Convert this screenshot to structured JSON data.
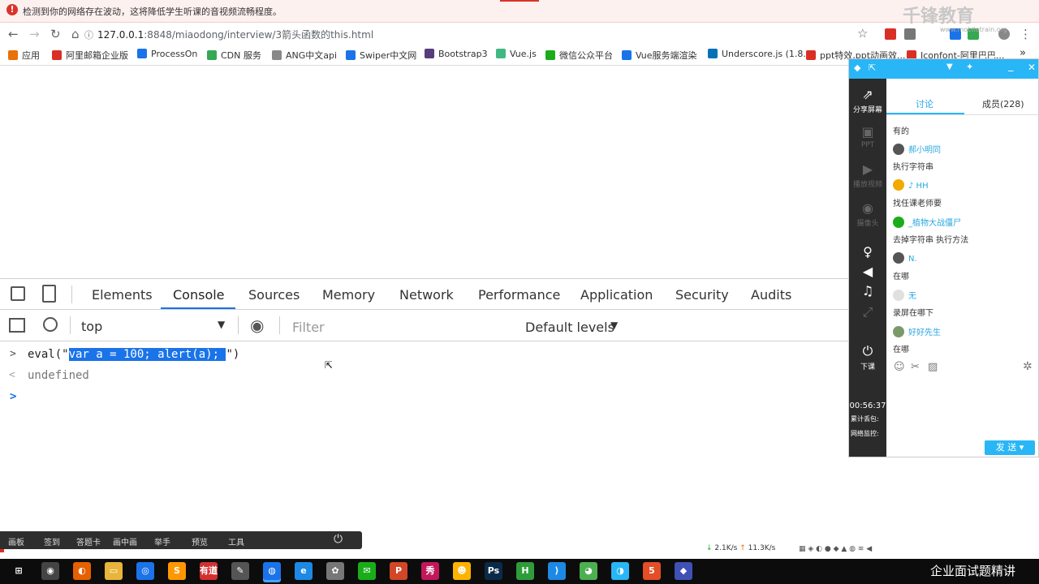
{
  "warning": {
    "text": "检测到你的网络存在波动，这将降低学生听课的音视频流畅程度。"
  },
  "logo": {
    "text": "千锋教育",
    "sub": "www.mobiletrain.org"
  },
  "addressbar": {
    "url_host": "127.0.0.1",
    "url_path": ":8848/miaodong/interview/3箭头函数的this.html"
  },
  "bookmarks": [
    {
      "label": "应用",
      "color": "#e8710a"
    },
    {
      "label": "阿里邮箱企业版",
      "color": "#d93025"
    },
    {
      "label": "ProcessOn",
      "color": "#1a73e8"
    },
    {
      "label": "CDN 服务",
      "color": "#34a853"
    },
    {
      "label": "ANG中文api",
      "color": "#888888"
    },
    {
      "label": "Swiper中文网",
      "color": "#1a73e8"
    },
    {
      "label": "Bootstrap3",
      "color": "#563d7c"
    },
    {
      "label": "Vue.js",
      "color": "#41b883"
    },
    {
      "label": "微信公众平台",
      "color": "#1aad19"
    },
    {
      "label": "Vue服务端渲染",
      "color": "#1a73e8"
    },
    {
      "label": "Underscore.js (1.8...",
      "color": "#0371b5"
    },
    {
      "label": "ppt特效,ppt动画效...",
      "color": "#d93025"
    },
    {
      "label": "Iconfont-阿里巴巴...",
      "color": "#d93025"
    }
  ],
  "devtools": {
    "tabs": [
      "Elements",
      "Console",
      "Sources",
      "Memory",
      "Network",
      "Performance",
      "Application",
      "Security",
      "Audits"
    ],
    "active_tab": "Console",
    "context": "top",
    "filter_placeholder": "Filter",
    "levels": "Default levels",
    "console": {
      "input_prefix": "eval(\"",
      "input_selected": "var a = 100; alert(a); ",
      "input_suffix": "\")",
      "output": "undefined"
    }
  },
  "chat": {
    "side_items": [
      "分享屏幕",
      "PPT",
      "播放视频",
      "摄像头",
      "下课"
    ],
    "timer": "00:56:37",
    "stats": [
      "累计丢包:",
      "网络监控:"
    ],
    "tabs": [
      "讨论",
      "成员(228)"
    ],
    "messages": [
      {
        "name": "",
        "text": "有的",
        "color": "#888888"
      },
      {
        "name": "郝小明同",
        "text": "执行字符串",
        "color": "#555555"
      },
      {
        "name": "♪ HH",
        "text": "找任课老师要",
        "color": "#f2a900"
      },
      {
        "name": "_植物大战僵尸",
        "text": "去掉字符串 执行方法",
        "color": "#1aad19"
      },
      {
        "name": "N.",
        "text": "在哪",
        "color": "#555555"
      },
      {
        "name": "无",
        "text": "录屏在哪下",
        "color": "#cccccc"
      },
      {
        "name": "好好先生",
        "text": "在哪",
        "color": "#7a9a6a"
      }
    ],
    "send": "发 送"
  },
  "bottombar": {
    "items": [
      "画板",
      "签到",
      "答题卡",
      "画中画",
      "举手",
      "预览",
      "工具"
    ]
  },
  "netspeed": {
    "down": "2.1K/s",
    "up": "11.3K/s"
  },
  "taskbar": {
    "caption": "企业面试题精讲",
    "apps": [
      {
        "name": "win",
        "color": "#0c0c0c",
        "glyph": "⊞"
      },
      {
        "name": "a1",
        "color": "#444444",
        "glyph": "◉"
      },
      {
        "name": "firefox",
        "color": "#e66000",
        "glyph": "◐"
      },
      {
        "name": "folder",
        "color": "#e8b43a",
        "glyph": "▭"
      },
      {
        "name": "a2",
        "color": "#1a73e8",
        "glyph": "◎"
      },
      {
        "name": "sublime",
        "color": "#ff9800",
        "glyph": "S"
      },
      {
        "name": "youdao",
        "color": "#d32f2f",
        "glyph": "有道"
      },
      {
        "name": "a3",
        "color": "#555555",
        "glyph": "✎"
      },
      {
        "name": "chrome",
        "color": "#1a73e8",
        "glyph": "◍"
      },
      {
        "name": "ie",
        "color": "#1e88e5",
        "glyph": "e"
      },
      {
        "name": "a4",
        "color": "#777777",
        "glyph": "✿"
      },
      {
        "name": "wechat",
        "color": "#1aad19",
        "glyph": "✉"
      },
      {
        "name": "ppt",
        "color": "#d24726",
        "glyph": "P"
      },
      {
        "name": "a5",
        "color": "#c2185b",
        "glyph": "秀"
      },
      {
        "name": "a6",
        "color": "#ffb300",
        "glyph": "☻"
      },
      {
        "name": "ps",
        "color": "#0b2a4a",
        "glyph": "Ps"
      },
      {
        "name": "hbuilder",
        "color": "#2e9c3b",
        "glyph": "H"
      },
      {
        "name": "vscode",
        "color": "#1e88e5",
        "glyph": "⟩"
      },
      {
        "name": "a7",
        "color": "#4caf50",
        "glyph": "◕"
      },
      {
        "name": "a8",
        "color": "#29b6f6",
        "glyph": "◑"
      },
      {
        "name": "html5",
        "color": "#e44d26",
        "glyph": "5"
      },
      {
        "name": "a9",
        "color": "#3f51b5",
        "glyph": "◆"
      }
    ]
  }
}
